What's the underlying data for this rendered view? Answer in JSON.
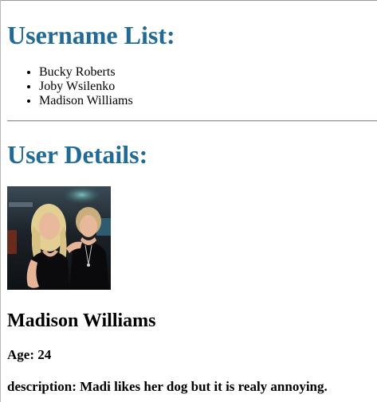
{
  "list_section": {
    "title": "Username List:",
    "users": [
      "Bucky Roberts",
      "Joby Wsilenko",
      "Madison Williams"
    ]
  },
  "details_section": {
    "title": "User Details:",
    "name": "Madison Williams",
    "age": "Age: 24",
    "description": "description: Madi likes her dog but it is realy annoying."
  },
  "colors": {
    "heading": "#1f6a97"
  }
}
